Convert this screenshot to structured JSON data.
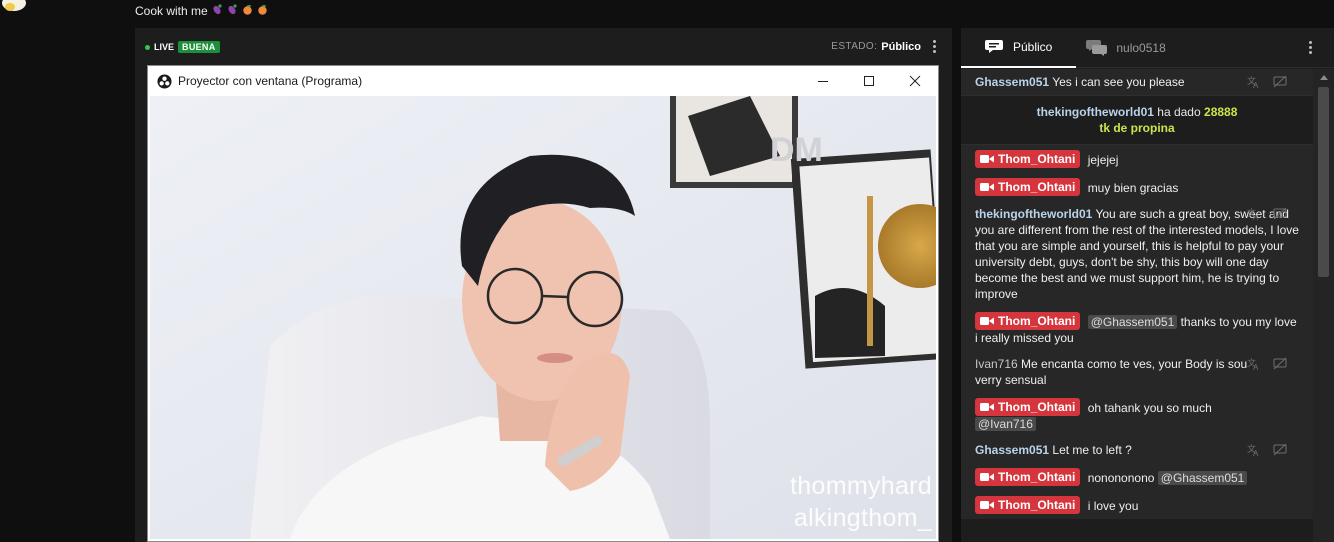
{
  "header": {
    "room_title": "Cook with me",
    "title_emojis": [
      "eggplant-icon",
      "eggplant-icon",
      "peach-icon",
      "peach-icon"
    ]
  },
  "stream": {
    "live_label": "LIVE",
    "quality_badge": "BUENA",
    "status_label": "ESTADO:",
    "status_value": "Público"
  },
  "projector": {
    "window_title": "Proyector con ventana (Programa)",
    "watermark_line1": "thommyhard",
    "watermark_line2": "alkingthom_",
    "logo_watermark": "DM"
  },
  "chat": {
    "tabs": [
      {
        "label": "Público",
        "icon": "public-chat-icon",
        "active": true
      },
      {
        "label": "nulo0518",
        "icon": "private-chat-icon",
        "active": false
      }
    ],
    "messages": [
      {
        "user": "Ghassem051",
        "text": "Yes i can see you please",
        "kind": "user"
      },
      {
        "kind": "tip",
        "user": "thekingoftheworld01",
        "text_mid": "ha dado",
        "amount": "28888",
        "text_after": "tk de propina"
      },
      {
        "user": "Thom_Ohtani",
        "text": "jejejej",
        "kind": "model"
      },
      {
        "user": "Thom_Ohtani",
        "text": "muy bien gracias",
        "kind": "model"
      },
      {
        "user": "thekingoftheworld01",
        "text": "You are such a great boy, sweet and you are different from the rest of the interested models, I love that you are simple and yourself, this is helpful to pay your university debt, guys, don't be shy, this boy will one day become the best and we must support him, he is trying to improve",
        "kind": "user"
      },
      {
        "user": "Thom_Ohtani",
        "mention": "@Ghassem051",
        "text": "thanks to you my love i really missed you",
        "kind": "model"
      },
      {
        "user": "Ivan716",
        "text": "Me encanta como te ves, your Body is sou verry sensual",
        "kind": "user"
      },
      {
        "user": "Thom_Ohtani",
        "text": "oh tahank you so much",
        "mention_after": "@Ivan716",
        "kind": "model"
      },
      {
        "user": "Ghassem051",
        "text": "Let me to left ?",
        "kind": "user"
      },
      {
        "user": "Thom_Ohtani",
        "text": "nonononono",
        "mention_after": "@Ghassem051",
        "kind": "model"
      },
      {
        "user": "Thom_Ohtani",
        "text": "i love you",
        "kind": "model"
      }
    ]
  },
  "colors": {
    "model_badge": "#d5363e",
    "tip_amount": "#c7e64a",
    "quality_badge": "#1c8f3b",
    "username": "#b9d3ea"
  }
}
